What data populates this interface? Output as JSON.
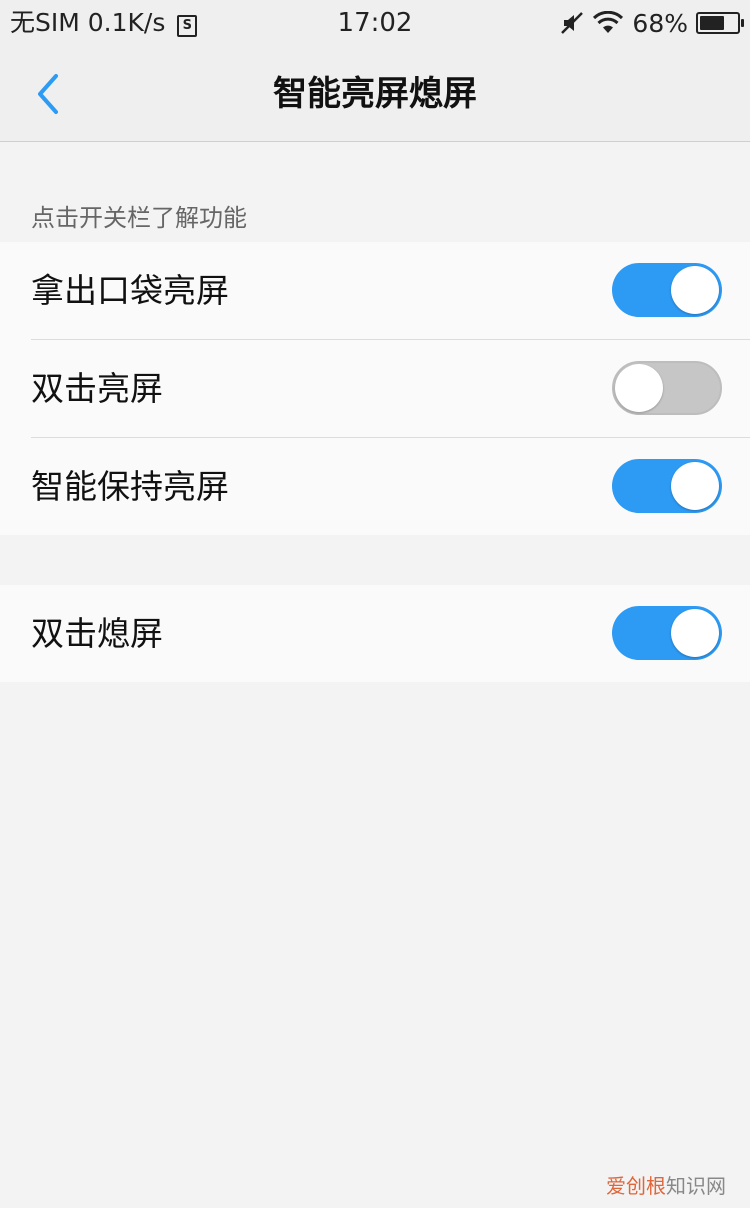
{
  "status_bar": {
    "carrier": "无SIM",
    "net_speed": "0.1K/s",
    "sim_icon_label": "S",
    "time": "17:02",
    "battery_percent": "68%",
    "battery_level": 0.68,
    "icons": [
      "mute-icon",
      "wifi-icon",
      "battery-icon"
    ]
  },
  "nav": {
    "back_icon": "chevron-left-icon",
    "title": "智能亮屏熄屏"
  },
  "section_hint": "点击开关栏了解功能",
  "group1": [
    {
      "label": "拿出口袋亮屏",
      "enabled": true
    },
    {
      "label": "双击亮屏",
      "enabled": false
    },
    {
      "label": "智能保持亮屏",
      "enabled": true
    }
  ],
  "group2": [
    {
      "label": "双击熄屏",
      "enabled": true
    }
  ],
  "watermark": {
    "brand": "爱创根",
    "suffix": "知识网"
  },
  "colors": {
    "toggle_on": "#2d9af4",
    "toggle_off": "#c6c6c6",
    "accent": "#2d9af4"
  }
}
